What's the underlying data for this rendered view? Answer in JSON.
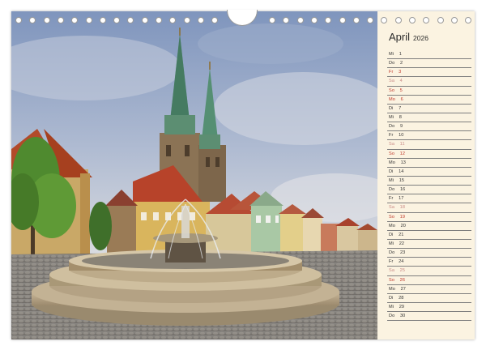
{
  "calendar": {
    "month": "April",
    "year": "2026",
    "days": [
      {
        "wd": "Mi",
        "n": "1",
        "type": "weekday"
      },
      {
        "wd": "Do",
        "n": "2",
        "type": "weekday"
      },
      {
        "wd": "Fr",
        "n": "3",
        "type": "holiday"
      },
      {
        "wd": "Sa",
        "n": "4",
        "type": "saturday"
      },
      {
        "wd": "So",
        "n": "5",
        "type": "sunday"
      },
      {
        "wd": "Mo",
        "n": "6",
        "type": "holiday"
      },
      {
        "wd": "Di",
        "n": "7",
        "type": "weekday"
      },
      {
        "wd": "Mi",
        "n": "8",
        "type": "weekday"
      },
      {
        "wd": "Do",
        "n": "9",
        "type": "weekday"
      },
      {
        "wd": "Fr",
        "n": "10",
        "type": "weekday"
      },
      {
        "wd": "Sa",
        "n": "11",
        "type": "saturday"
      },
      {
        "wd": "So",
        "n": "12",
        "type": "sunday"
      },
      {
        "wd": "Mo",
        "n": "13",
        "type": "weekday"
      },
      {
        "wd": "Di",
        "n": "14",
        "type": "weekday"
      },
      {
        "wd": "Mi",
        "n": "15",
        "type": "weekday"
      },
      {
        "wd": "Do",
        "n": "16",
        "type": "weekday"
      },
      {
        "wd": "Fr",
        "n": "17",
        "type": "weekday"
      },
      {
        "wd": "Sa",
        "n": "18",
        "type": "saturday"
      },
      {
        "wd": "So",
        "n": "19",
        "type": "sunday"
      },
      {
        "wd": "Mo",
        "n": "20",
        "type": "weekday"
      },
      {
        "wd": "Di",
        "n": "21",
        "type": "weekday"
      },
      {
        "wd": "Mi",
        "n": "22",
        "type": "weekday"
      },
      {
        "wd": "Do",
        "n": "23",
        "type": "weekday"
      },
      {
        "wd": "Fr",
        "n": "24",
        "type": "weekday"
      },
      {
        "wd": "Sa",
        "n": "25",
        "type": "saturday"
      },
      {
        "wd": "So",
        "n": "26",
        "type": "sunday"
      },
      {
        "wd": "Mo",
        "n": "27",
        "type": "weekday"
      },
      {
        "wd": "Di",
        "n": "28",
        "type": "weekday"
      },
      {
        "wd": "Mi",
        "n": "29",
        "type": "weekday"
      },
      {
        "wd": "Do",
        "n": "30",
        "type": "weekday"
      }
    ]
  },
  "photo": {
    "subject": "old-town-square-with-fountain-and-twin-spired-church"
  },
  "colors": {
    "paper": "#fbf3e1",
    "sunday": "#c0392b",
    "saturday": "#c98a86",
    "spire": "#4f8a6e",
    "sky": "#8ea3c4"
  }
}
